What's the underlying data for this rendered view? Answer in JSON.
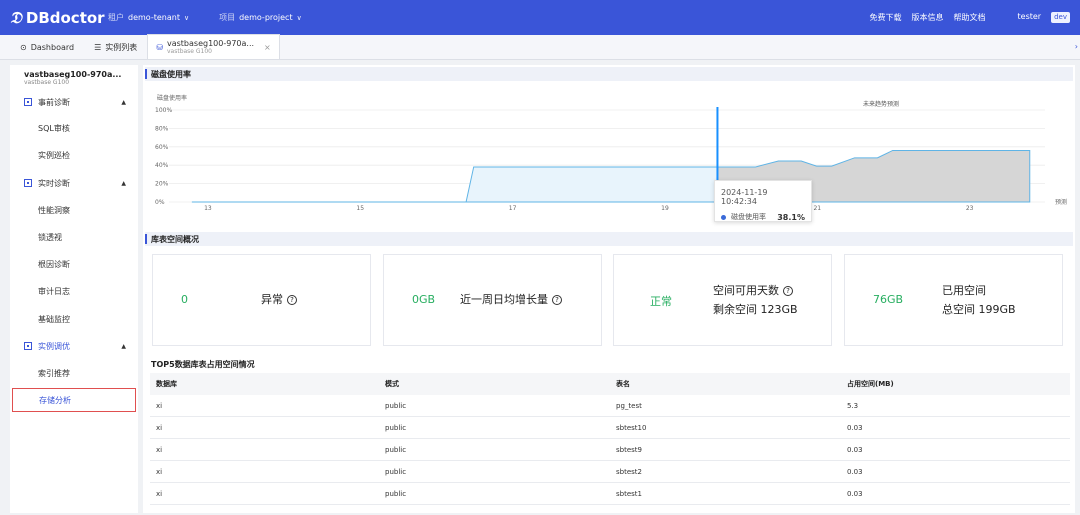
{
  "header": {
    "logo": "DBdoctor",
    "tenant_label": "租户",
    "tenant_value": "demo-tenant",
    "project_label": "项目",
    "project_value": "demo-project",
    "links": [
      "免费下载",
      "版本信息",
      "帮助文档"
    ],
    "user": "tester",
    "user_badge": "dev"
  },
  "tabs": {
    "dashboard": "Dashboard",
    "instances": "实例列表",
    "active_title": "vastbaseg100-970a...",
    "active_sub": "vastbase G100"
  },
  "sidebar": {
    "instance_name": "vastbaseg100-970a...",
    "instance_type": "vastbase G100",
    "groups": [
      {
        "label": "事前诊断",
        "items": [
          "SQL审核",
          "实例巡检"
        ]
      },
      {
        "label": "实时诊断",
        "items": [
          "性能洞察",
          "锁透视",
          "根因诊断",
          "审计日志",
          "基础监控"
        ]
      },
      {
        "label": "实例调优",
        "items": [
          "索引推荐",
          "存储分析"
        ]
      }
    ],
    "active_item": "存储分析"
  },
  "disk_section": {
    "title": "磁盘使用率"
  },
  "chart_data": {
    "type": "area",
    "ylabel": "磁盘使用率",
    "y_ticks": [
      "100%",
      "80%",
      "60%",
      "40%",
      "20%",
      "0%"
    ],
    "ylim": [
      0,
      100
    ],
    "x_ticks": [
      "13",
      "15",
      "17",
      "19",
      "21",
      "23"
    ],
    "x_end_label": "预测",
    "forecast_label": "未来趋势预测",
    "series": [
      {
        "name": "磁盘使用率",
        "x": [
          12.8,
          16.4,
          16.5,
          19.7
        ],
        "values": [
          0,
          0,
          38.1,
          38.1
        ]
      },
      {
        "name": "预测",
        "x": [
          19.7,
          20.2,
          20.5,
          20.8,
          21.0,
          21.2,
          21.5,
          21.8,
          22.0,
          22.3,
          22.5,
          22.8,
          23.8
        ],
        "values": [
          38.1,
          38.1,
          44.6,
          44.6,
          39.0,
          39.0,
          48.0,
          48.0,
          56.0,
          56.0,
          56.0,
          56.0,
          56.0
        ]
      }
    ],
    "cursor_x": 19.7,
    "grid": true
  },
  "tooltip": {
    "timestamp": "2024-11-19 10:42:34",
    "series": "磁盘使用率",
    "value": "38.1%"
  },
  "space_section": {
    "title": "库表空间概况"
  },
  "cards": [
    {
      "value": "0",
      "label": "异常"
    },
    {
      "value": "0GB",
      "label": "近一周日均增长量"
    },
    {
      "value": "正常",
      "label": "空间可用天数",
      "label2": "剩余空间 123GB"
    },
    {
      "value": "76GB",
      "label": "已用空间",
      "label2": "总空间 199GB"
    }
  ],
  "top5": {
    "title": "TOP5数据库表占用空间情况",
    "columns": [
      "数据库",
      "模式",
      "表名",
      "占用空间(MB)"
    ],
    "rows": [
      [
        "xi",
        "public",
        "pg_test",
        "5.3"
      ],
      [
        "xi",
        "public",
        "sbtest10",
        "0.03"
      ],
      [
        "xi",
        "public",
        "sbtest9",
        "0.03"
      ],
      [
        "xi",
        "public",
        "sbtest2",
        "0.03"
      ],
      [
        "xi",
        "public",
        "sbtest1",
        "0.03"
      ]
    ]
  },
  "colors": {
    "brand": "#3a55d8",
    "positive": "#27ae60",
    "area_line": "#5fb4e6",
    "forecast_fill": "#d6d6d6",
    "cursor": "#1890ff"
  }
}
